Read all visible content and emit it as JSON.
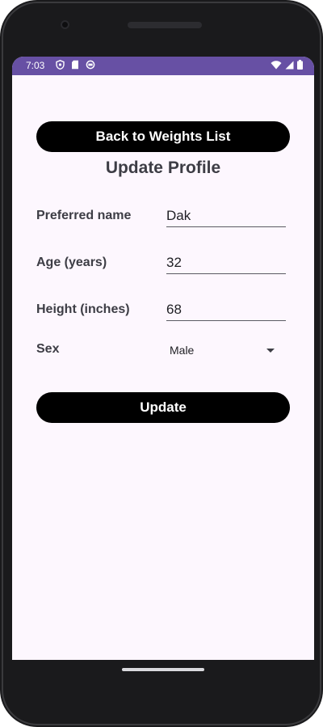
{
  "status_bar": {
    "time": "7:03",
    "left_icons": [
      "shield-icon",
      "sd-card-icon",
      "sync-icon"
    ],
    "right_icons": [
      "wifi-icon",
      "signal-icon",
      "battery-icon"
    ],
    "color": "#6750a4"
  },
  "top_button": {
    "label": "Back to Weights List"
  },
  "page": {
    "title": "Update Profile"
  },
  "form": {
    "preferred_name": {
      "label": "Preferred name",
      "value": "Dak"
    },
    "age": {
      "label": "Age (years)",
      "value": "32"
    },
    "height": {
      "label": "Height (inches)",
      "value": "68"
    },
    "sex": {
      "label": "Sex",
      "selected": "Male"
    }
  },
  "actions": {
    "update_label": "Update"
  },
  "colors": {
    "screen_background": "#fdf7fe",
    "button_background": "#000000",
    "button_text": "#ffffff",
    "label_text": "#3d3d45"
  }
}
